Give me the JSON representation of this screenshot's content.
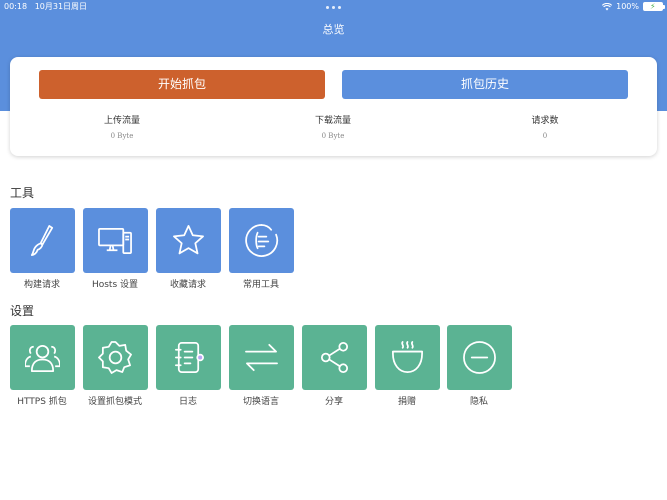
{
  "status_bar": {
    "time": "00:18",
    "date": "10月31日周日",
    "battery": "100%"
  },
  "nav": {
    "title": "总览"
  },
  "overview": {
    "start_button": "开始抓包",
    "history_button": "抓包历史",
    "stats": [
      {
        "label": "上传流量",
        "value": "0 Byte"
      },
      {
        "label": "下载流量",
        "value": "0 Byte"
      },
      {
        "label": "请求数",
        "value": "0"
      }
    ]
  },
  "tools": {
    "title": "工具",
    "items": [
      {
        "label": "构建请求",
        "icon": "brush-icon"
      },
      {
        "label": "Hosts 设置",
        "icon": "computer-icon"
      },
      {
        "label": "收藏请求",
        "icon": "star-icon"
      },
      {
        "label": "常用工具",
        "icon": "tools-icon"
      }
    ]
  },
  "settings": {
    "title": "设置",
    "items": [
      {
        "label": "HTTPS 抓包",
        "icon": "users-icon"
      },
      {
        "label": "设置抓包模式",
        "icon": "gear-icon"
      },
      {
        "label": "日志",
        "icon": "notebook-icon"
      },
      {
        "label": "切换语言",
        "icon": "swap-icon"
      },
      {
        "label": "分享",
        "icon": "share-icon"
      },
      {
        "label": "捐赠",
        "icon": "coffee-icon"
      },
      {
        "label": "隐私",
        "icon": "minus-circle-icon"
      }
    ]
  },
  "colors": {
    "primary": "#5b8fdd",
    "accent": "#cd612d",
    "green": "#5bb393"
  }
}
